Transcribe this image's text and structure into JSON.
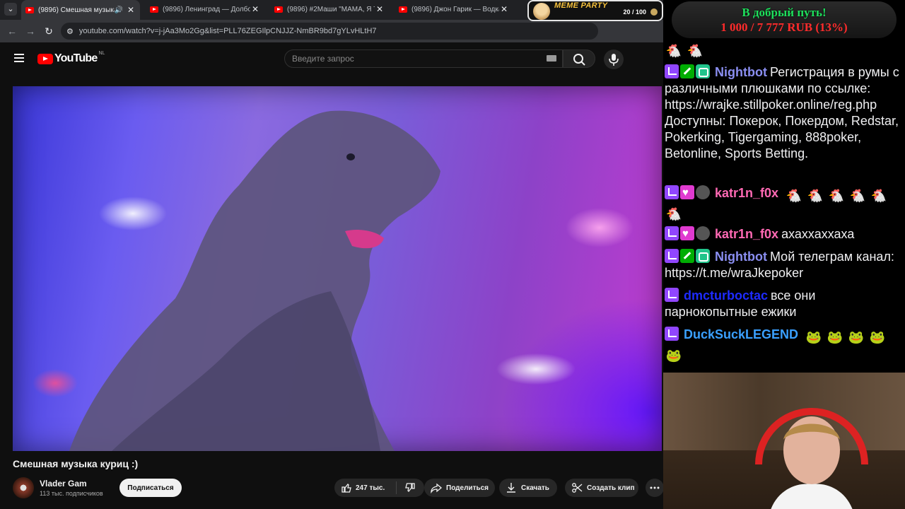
{
  "browser": {
    "tabs": [
      {
        "title": "(9896) Смешная музыка ку",
        "active": true
      },
      {
        "title": "(9896) Ленинград — Долбояш",
        "active": false
      },
      {
        "title": "(9896) #2Маши \"МАМА, Я ТАН",
        "active": false
      },
      {
        "title": "(9896) Джон Гарик — Водка З",
        "active": false
      }
    ],
    "url": "youtube.com/watch?v=j-jAa3Mo2Gg&list=PLL76ZEGIlpCNJJZ-NmBR9bd7gYLvHLtH7"
  },
  "youtube": {
    "logo_text": "YouTube",
    "logo_region": "NL",
    "search_placeholder": "Введите запрос",
    "video": {
      "title": "Смешная музыка куриц :)",
      "channel": "Vlader Gam",
      "subscribers": "113 тыс. подписчиков",
      "subscribe_label": "Подписаться",
      "likes": "247 тыс.",
      "share_label": "Поделиться",
      "download_label": "Скачать",
      "clip_label": "Создать клип"
    }
  },
  "overlay": {
    "meme_party_label": "MEME PARTY",
    "meme_party_count": "20 / 100",
    "goal_title": "В добрый путь!",
    "goal_amount": "1 000 / 7 777 RUB (13%)"
  },
  "chat": {
    "messages": [
      {
        "user": "",
        "user_color": "#efeff1",
        "text": "",
        "badges": [],
        "emotes": 2
      },
      {
        "user": "Nightbot",
        "user_color": "#8a8ef0",
        "badges": [
          "twitch",
          "mod",
          "bot"
        ],
        "text": "Регистрация в румы с различными плюшками по ссылке: https://wrajke.stillpoker.online/reg.php Доступны: Покерок, Покердом, Redstar, Pokerking, Tigergaming, 888poker, Betonline, Sports Betting."
      },
      {
        "user": "katr1n_f0x",
        "user_color": "#ff69b4",
        "badges": [
          "twitch",
          "sub",
          "gear"
        ],
        "text": "",
        "emotes": 6
      },
      {
        "user": "katr1n_f0x",
        "user_color": "#ff69b4",
        "badges": [
          "twitch",
          "sub",
          "gear"
        ],
        "text": "ахаххаххаха"
      },
      {
        "user": "Nightbot",
        "user_color": "#8a8ef0",
        "badges": [
          "twitch",
          "mod",
          "bot"
        ],
        "text": "Мой телеграм канал: https://t.me/wraJkepoker"
      },
      {
        "user": "dmcturboctac",
        "user_color": "#1e2bff",
        "badges": [
          "twitch"
        ],
        "text": "все они парнокопытные ежики"
      },
      {
        "user": "DuckSuckLEGEND",
        "user_color": "#3aa0ff",
        "badges": [
          "twitch"
        ],
        "text": "",
        "emotes": 5
      }
    ]
  }
}
